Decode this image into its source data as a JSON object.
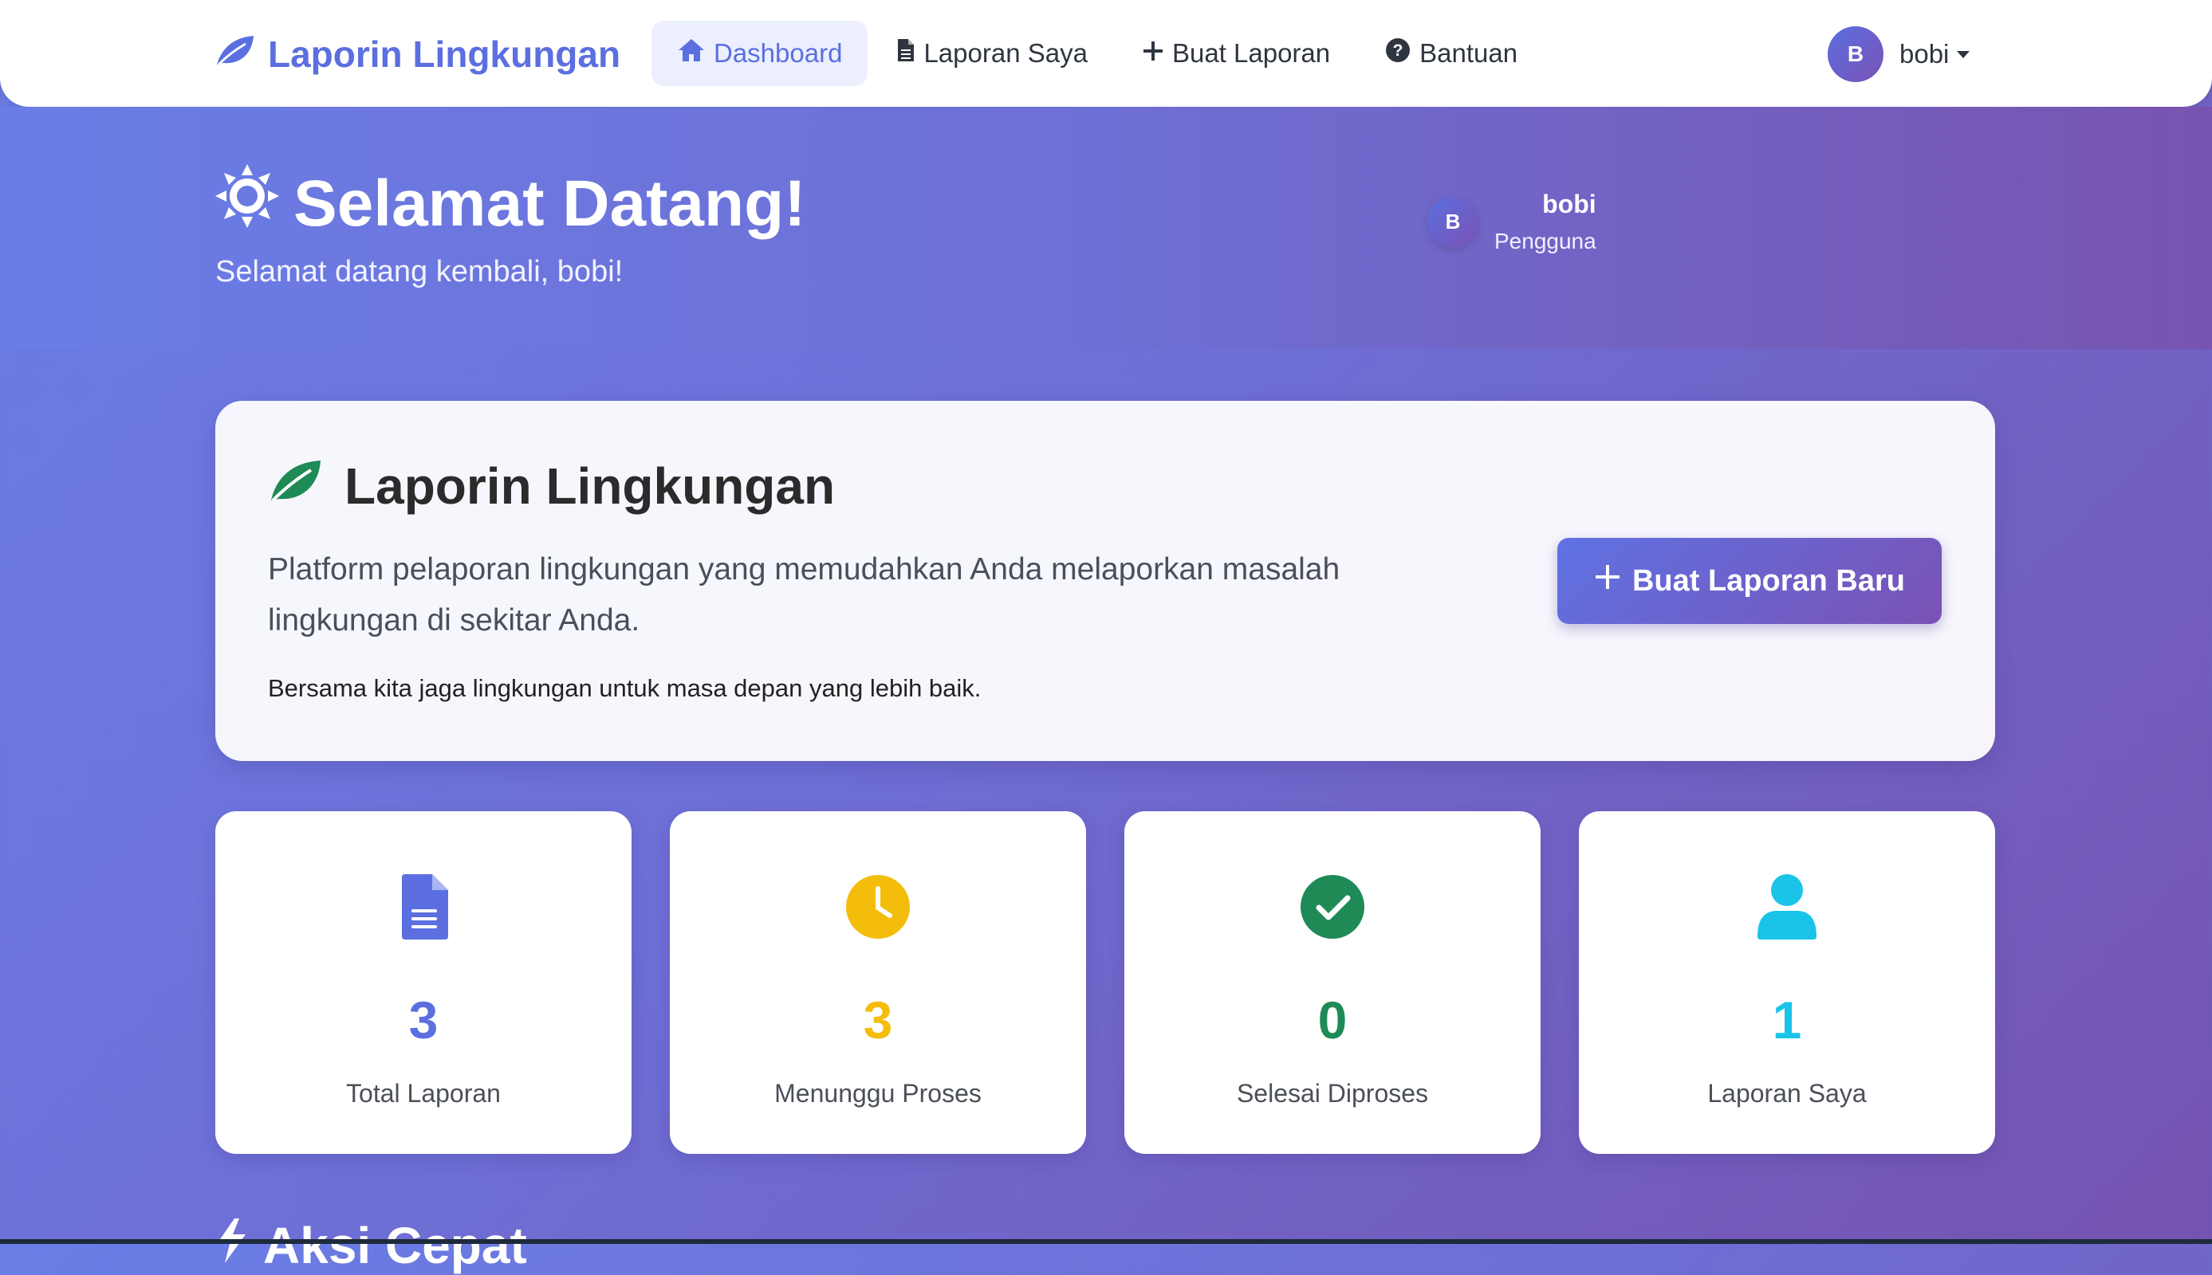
{
  "navbar": {
    "brand": "Laporin Lingkungan",
    "items": [
      {
        "label": "Dashboard",
        "icon": "home-icon",
        "active": true
      },
      {
        "label": "Laporan Saya",
        "icon": "document-icon"
      },
      {
        "label": "Buat Laporan",
        "icon": "plus-icon"
      },
      {
        "label": "Bantuan",
        "icon": "help-icon"
      }
    ],
    "user": {
      "initial": "B",
      "name": "bobi"
    }
  },
  "hero": {
    "title": "Selamat Datang!",
    "subtitle": "Selamat datang kembali, bobi!",
    "user": {
      "initial": "B",
      "name": "bobi",
      "role": "Pengguna"
    }
  },
  "info": {
    "title": "Laporin Lingkungan",
    "description": "Platform pelaporan lingkungan yang memudahkan Anda melaporkan masalah lingkungan di sekitar Anda.",
    "note": "Bersama kita jaga lingkungan untuk masa depan yang lebih baik.",
    "cta_label": "Buat Laporan Baru"
  },
  "stats": [
    {
      "value": "3",
      "label": "Total Laporan",
      "icon": "document-icon",
      "color": "#5b6fe0"
    },
    {
      "value": "3",
      "label": "Menunggu Proses",
      "icon": "clock-icon",
      "color": "#f5bd0b"
    },
    {
      "value": "0",
      "label": "Selesai Diproses",
      "icon": "check-circle-icon",
      "color": "#1e8a56"
    },
    {
      "value": "1",
      "label": "Laporan Saya",
      "icon": "user-icon",
      "color": "#1ac4e8"
    }
  ],
  "next_section": {
    "title": "Aksi Cepat"
  },
  "colors": {
    "primary": "#5b6fe0",
    "gradient_start": "#6a7ee6",
    "gradient_end": "#7553b0",
    "leaf_green": "#1e8a56"
  }
}
